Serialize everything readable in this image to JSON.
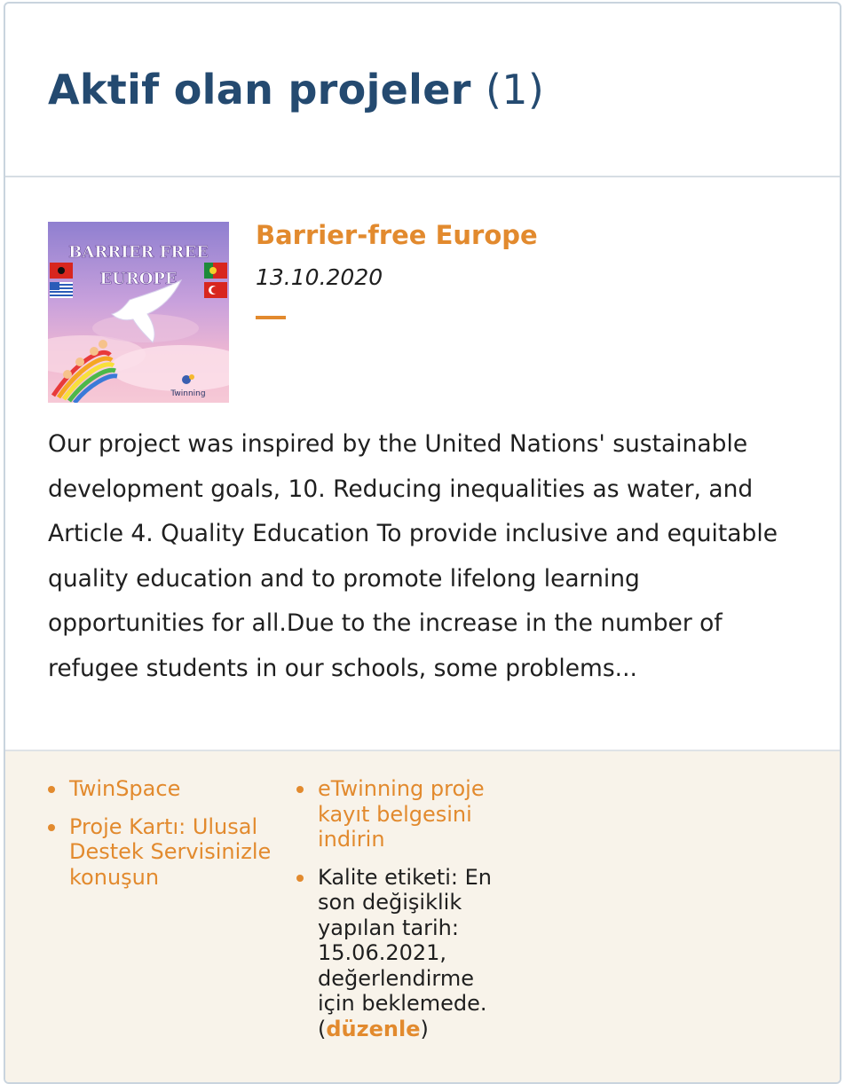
{
  "header": {
    "title": "Aktif olan projeler",
    "count": "(1)"
  },
  "project": {
    "thumbnail": {
      "title_line1": "BARRIER FREE",
      "title_line2": "EUROPE",
      "logo_text": "Twinning"
    },
    "title": "Barrier-free Europe",
    "date": "13.10.2020",
    "description": "Our project was inspired by the United Nations' sustainable development goals, 10. Reducing inequalities as water, and Article 4. Quality Education To provide inclusive and equitable quality education and to promote lifelong learning opportunities for all.Due to the increase in the number of refugee students in our schools, some problems..."
  },
  "links": {
    "twinspace": "TwinSpace",
    "project_card": "Proje Kartı: Ulusal Destek Servisinizle konuşun",
    "download_certificate": "eTwinning proje kayıt belgesini indirin",
    "quality_label_text": "Kalite etiketi: En son değişiklik yapılan tarih: 15.06.2021, değerlendirme için beklemede. (",
    "edit_label": "düzenle",
    "close_paren": ")"
  },
  "colors": {
    "title_blue": "#244a70",
    "accent_orange": "#e28a2e",
    "footer_bg": "#f8f3ea",
    "border": "#c9d4de"
  }
}
